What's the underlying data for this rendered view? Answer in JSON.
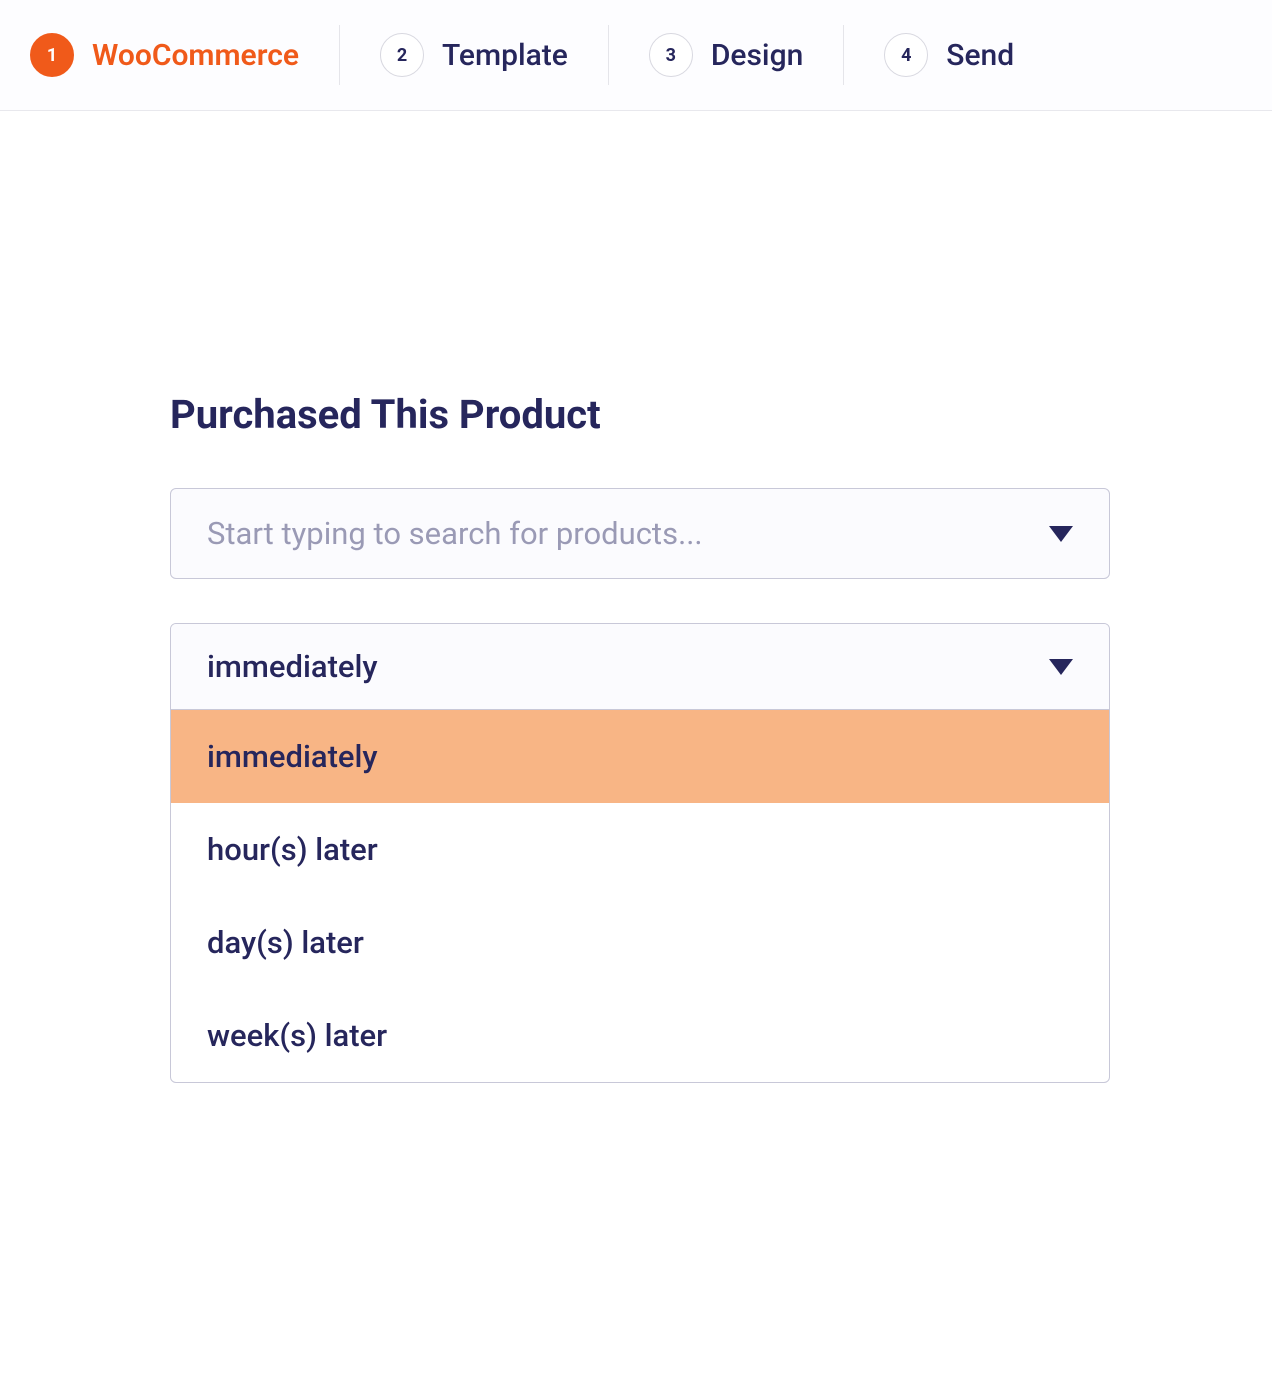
{
  "stepper": {
    "steps": [
      {
        "num": "1",
        "label": "WooCommerce"
      },
      {
        "num": "2",
        "label": "Template"
      },
      {
        "num": "3",
        "label": "Design"
      },
      {
        "num": "4",
        "label": "Send"
      }
    ]
  },
  "main": {
    "section_title": "Purchased This Product",
    "product_search": {
      "placeholder": "Start typing to search for products..."
    },
    "timing_select": {
      "selected": "immediately",
      "options": [
        "immediately",
        "hour(s) later",
        "day(s) later",
        "week(s) later"
      ]
    }
  }
}
